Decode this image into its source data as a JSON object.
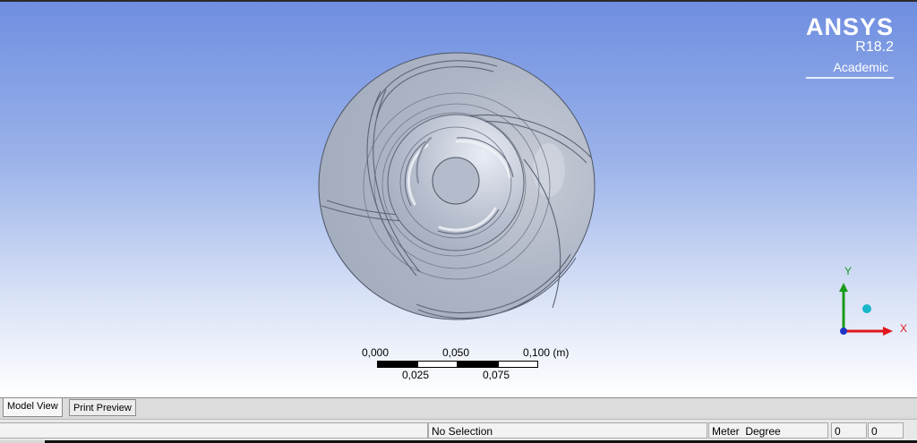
{
  "brand": {
    "name": "ANSYS",
    "version": "R18.2",
    "edition": "Academic"
  },
  "scale_bar": {
    "top_labels": [
      "0,000",
      "0,050",
      "0,100 (m)"
    ],
    "bottom_labels": [
      "0,025",
      "0,075"
    ]
  },
  "triad": {
    "x_label": "X",
    "y_label": "Y",
    "x_color": "#e0161c",
    "y_color": "#1a9a1a",
    "z_color": "#1f35c8",
    "iso_ball_color": "#19b6c8"
  },
  "tabs": [
    {
      "label": "Model View",
      "active": true
    },
    {
      "label": "Print Preview",
      "active": false
    }
  ],
  "status": {
    "selection": "No Selection",
    "units": "Meter  Degree",
    "field1": "0",
    "field2": "0"
  },
  "colors": {
    "viewport_top": "#6f8ee0",
    "viewport_bottom": "#ffffff",
    "model_fill": "#aab3c4"
  }
}
